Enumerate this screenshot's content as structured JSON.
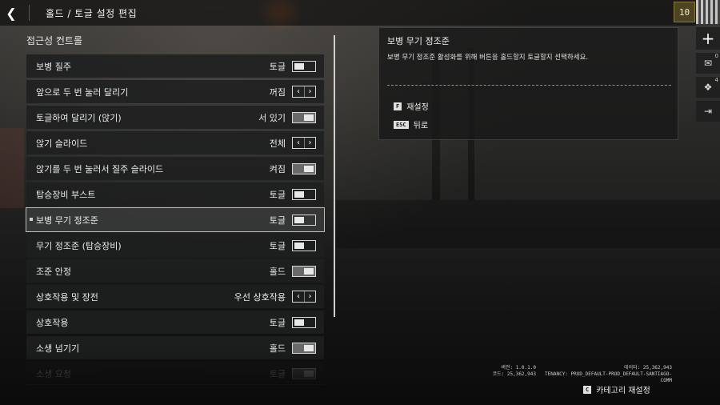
{
  "header": {
    "back_icon": "chevron-left-icon",
    "breadcrumb": "홀드 / 토글 설정 편집"
  },
  "player": {
    "level": "10"
  },
  "rail": {
    "mail_count": "0",
    "gift_count": "4"
  },
  "section": {
    "title": "접근성 컨트롤"
  },
  "settings": [
    {
      "label": "보병 질주",
      "value": "토글",
      "control": "toggle",
      "state": "off"
    },
    {
      "label": "앞으로 두 번 눌러 달리기",
      "value": "꺼짐",
      "control": "stepper"
    },
    {
      "label": "토글하여 달리기 (앉기)",
      "value": "서 있기",
      "control": "toggle",
      "state": "on"
    },
    {
      "label": "앉기 슬라이드",
      "value": "전체",
      "control": "stepper"
    },
    {
      "label": "앉기를 두 번 눌러서 질주 슬라이드",
      "value": "켜짐",
      "control": "toggle",
      "state": "on"
    },
    {
      "label": "탑승장비 부스트",
      "value": "토글",
      "control": "toggle",
      "state": "off"
    },
    {
      "label": "보병 무기 정조준",
      "value": "토글",
      "control": "toggle",
      "state": "off",
      "selected": true
    },
    {
      "label": "무기 정조준 (탑승장비)",
      "value": "토글",
      "control": "toggle",
      "state": "off"
    },
    {
      "label": "조준 안정",
      "value": "홀드",
      "control": "toggle",
      "state": "on"
    },
    {
      "label": "상호작용 및 장전",
      "value": "우선 상호작용",
      "control": "stepper"
    },
    {
      "label": "상호작용",
      "value": "토글",
      "control": "toggle",
      "state": "off"
    },
    {
      "label": "소생 넘기기",
      "value": "홀드",
      "control": "toggle",
      "state": "on"
    },
    {
      "label": "소생 요청",
      "value": "토글",
      "control": "toggle",
      "state": "on",
      "faded": true
    }
  ],
  "details": {
    "title": "보병 무기 정조준",
    "description": "보병 무기 정조준 활성화를 위해 버튼을 홀드할지 토글할지 선택하세요.",
    "reset_key": "F",
    "reset_label": "재설정",
    "back_key": "ESC",
    "back_label": "뒤로"
  },
  "build": {
    "version": "버전: 1.0.1.0",
    "code": "코드: 25,362,943",
    "data": "데이터: 25,362,943",
    "tenancy": "TENANCY: PROD_DEFAULT-PROD_DEFAULT-SANTIAGO-COMM"
  },
  "footer": {
    "category_reset_key": "C",
    "category_reset_label": "카테고리 재설정"
  }
}
